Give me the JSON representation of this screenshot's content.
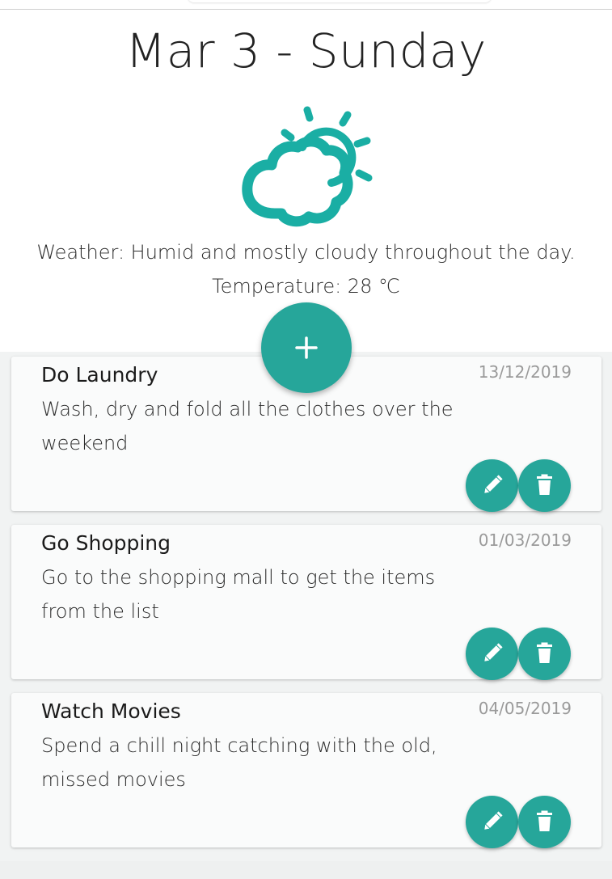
{
  "header": {
    "date_title": "Mar 3 - Sunday",
    "weather_icon": "partly-cloudy-icon",
    "weather_text": "Weather: Humid and mostly cloudy throughout the day.",
    "temperature_text": "Temperature: 28 ℃"
  },
  "add_button": {
    "icon": "plus-icon"
  },
  "tasks": [
    {
      "title": "Do Laundry",
      "date": "13/12/2019",
      "description": "Wash, dry and fold all the clothes over the weekend"
    },
    {
      "title": "Go Shopping",
      "date": "01/03/2019",
      "description": "Go to the shopping mall to get the items from the list"
    },
    {
      "title": "Watch Movies",
      "date": "04/05/2019",
      "description": "Spend a chill night catching with the old, missed movies"
    }
  ],
  "colors": {
    "accent": "#26a69a",
    "weather_icon": "#1aaea4",
    "date_text": "#9a9a9a"
  }
}
